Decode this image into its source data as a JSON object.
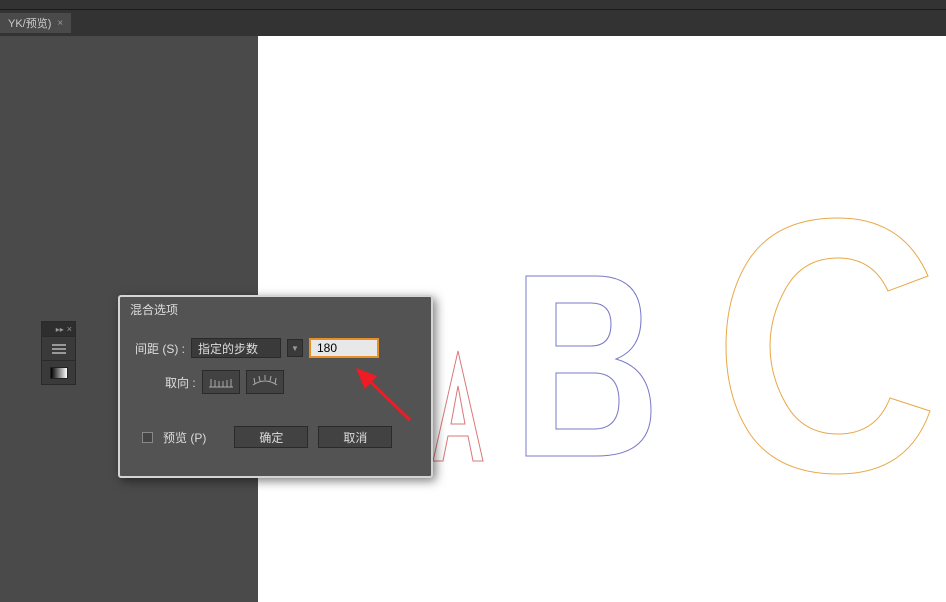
{
  "tab": {
    "label": "YK/预览)",
    "close_icon": "×"
  },
  "mini_panel": {
    "arrows_icon": "▸▸",
    "close_icon": "×"
  },
  "dialog": {
    "title": "混合选项",
    "spacing_label": "间距 (S) :",
    "spacing_mode": "指定的步数",
    "spacing_value": "180",
    "orientation_label": "取向 :",
    "preview_label": "预览 (P)",
    "ok_label": "确定",
    "cancel_label": "取消"
  },
  "canvas": {
    "letters": {
      "a": "A",
      "b": "B",
      "c": "C"
    }
  },
  "colors": {
    "a_stroke": "#d97878",
    "b_stroke": "#7878c8",
    "c_stroke": "#e8a848"
  }
}
